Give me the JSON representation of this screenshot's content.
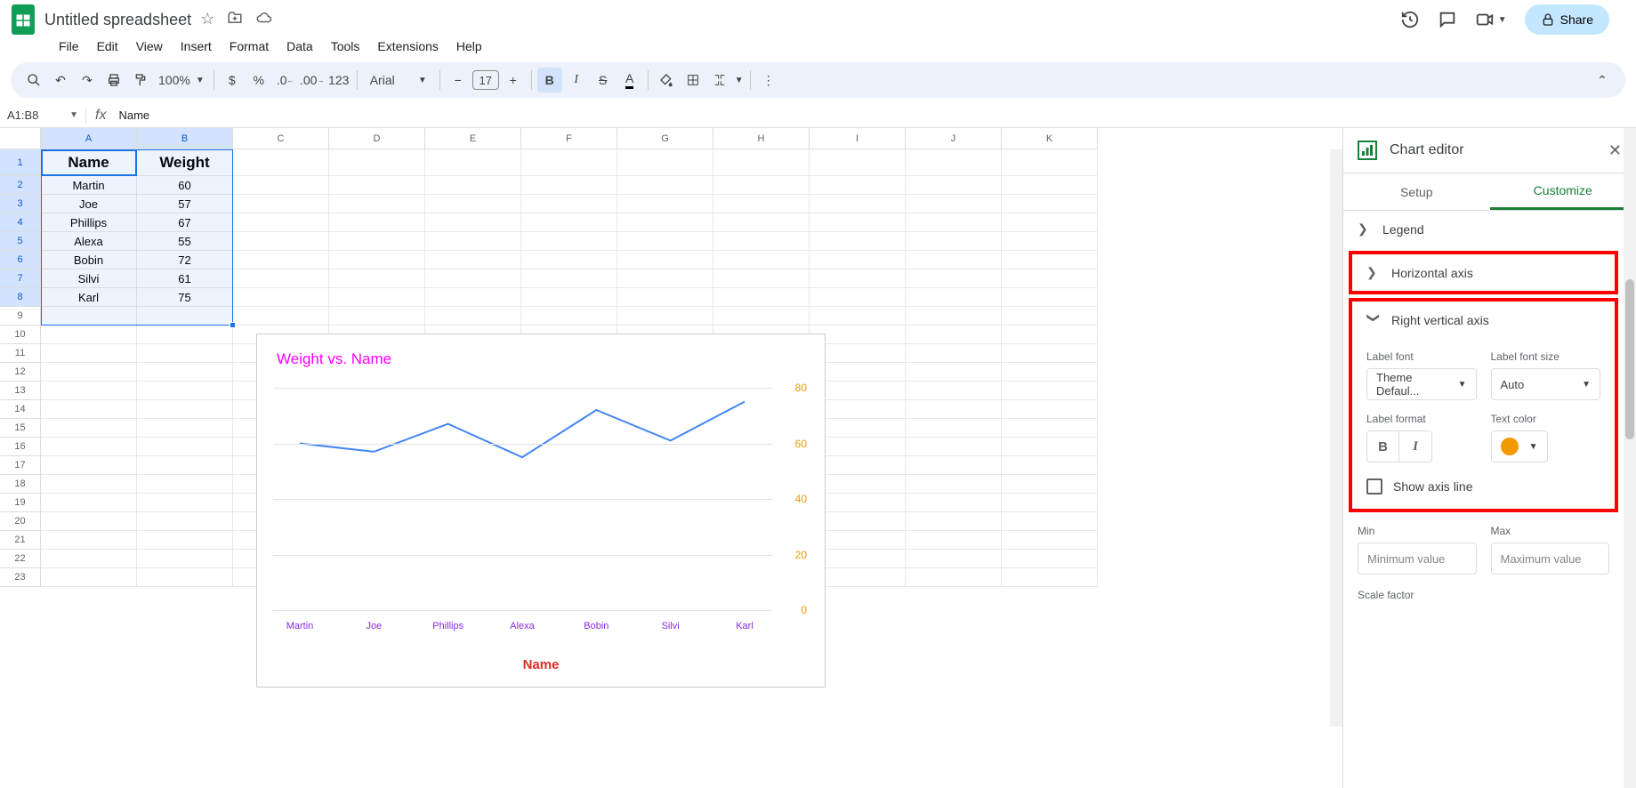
{
  "header": {
    "title": "Untitled spreadsheet",
    "share": "Share"
  },
  "menu": {
    "file": "File",
    "edit": "Edit",
    "view": "View",
    "insert": "Insert",
    "format": "Format",
    "data": "Data",
    "tools": "Tools",
    "extensions": "Extensions",
    "help": "Help"
  },
  "toolbar": {
    "zoom": "100%",
    "font": "Arial",
    "fontsize": "17",
    "numfmt": "123"
  },
  "namebox": "A1:B8",
  "formula": "Name",
  "columns": [
    "A",
    "B",
    "C",
    "D",
    "E",
    "F",
    "G",
    "H",
    "I",
    "J",
    "K"
  ],
  "rows": [
    "1",
    "2",
    "3",
    "4",
    "5",
    "6",
    "7",
    "8",
    "9",
    "10",
    "11",
    "12",
    "13",
    "14",
    "15",
    "16",
    "17",
    "18",
    "19",
    "20",
    "21",
    "22",
    "23"
  ],
  "table": {
    "headers": [
      "Name",
      "Weight"
    ],
    "data": [
      [
        "Martin",
        "60"
      ],
      [
        "Joe",
        "57"
      ],
      [
        "Phillips",
        "67"
      ],
      [
        "Alexa",
        "55"
      ],
      [
        "Bobin",
        "72"
      ],
      [
        "Silvi",
        "61"
      ],
      [
        "Karl",
        "75"
      ]
    ]
  },
  "chart_data": {
    "type": "line",
    "title": "Weight vs. Name",
    "xlabel": "Name",
    "ylabel": "",
    "categories": [
      "Martin",
      "Joe",
      "Phillips",
      "Alexa",
      "Bobin",
      "Silvi",
      "Karl"
    ],
    "values": [
      60,
      57,
      67,
      55,
      72,
      61,
      75
    ],
    "ylim": [
      0,
      80
    ],
    "yticks": [
      0,
      20,
      40,
      60,
      80
    ],
    "axis_label_color": "#f29900",
    "x_category_color": "#8a2be2",
    "title_color": "#ff00ff",
    "xlabel_color": "#d93025",
    "line_color": "#4285f4"
  },
  "sidebar": {
    "title": "Chart editor",
    "tab_setup": "Setup",
    "tab_customize": "Customize",
    "section_legend": "Legend",
    "section_haxis": "Horizontal axis",
    "section_rvaxis": "Right vertical axis",
    "label_font": "Label font",
    "label_font_size": "Label font size",
    "font_value": "Theme Defaul...",
    "fontsize_value": "Auto",
    "label_format": "Label format",
    "text_color": "Text color",
    "text_color_value": "#f29900",
    "show_axis_line": "Show axis line",
    "min_label": "Min",
    "max_label": "Max",
    "min_placeholder": "Minimum value",
    "max_placeholder": "Maximum value",
    "scale_factor": "Scale factor"
  }
}
